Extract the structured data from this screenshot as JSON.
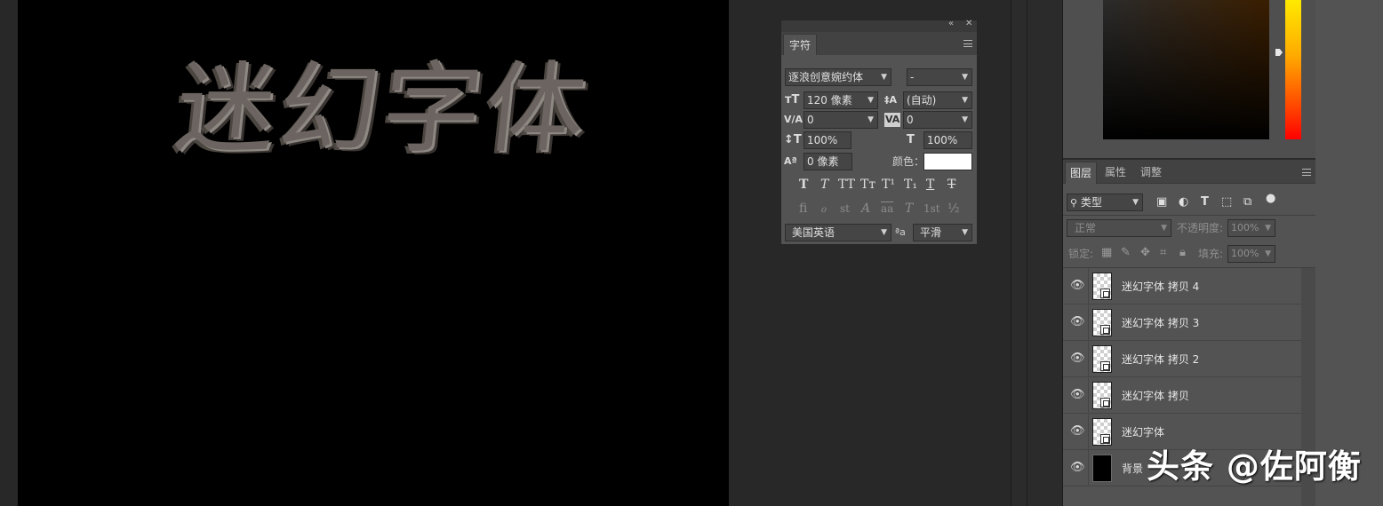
{
  "canvas": {
    "text": "迷幻字体"
  },
  "character_panel": {
    "collapse_icon": "double-chevron-left",
    "close_icon": "close-x",
    "tab_label": "字符",
    "font_family": "逐浪创意婉约体",
    "font_style": "-",
    "font_size": "120 像素",
    "leading": "(自动)",
    "kerning": "0",
    "tracking": "0",
    "vertical_scale": "100%",
    "horizontal_scale": "100%",
    "baseline_shift": "0 像素",
    "color_label": "颜色：",
    "color_value": "#ffffff",
    "style_glyphs": [
      "T",
      "T",
      "TT",
      "Tт",
      "T¹",
      "T₁",
      "T",
      "T"
    ],
    "opentype_glyphs": [
      "ﬁ",
      "ℴ",
      "st",
      "A",
      "aa",
      "T",
      "1st",
      "½"
    ],
    "language": "美国英语",
    "aa_label": "ªa",
    "antialias": "平滑"
  },
  "layers_panel": {
    "tabs": [
      "图层",
      "属性",
      "调整"
    ],
    "filter_kind": "类型",
    "blend_mode": "正常",
    "opacity_label": "不透明度:",
    "opacity_value": "100%",
    "lock_label": "锁定:",
    "fill_label": "填充:",
    "fill_value": "100%",
    "layers": [
      {
        "name": "迷幻字体 拷贝 4",
        "type": "smart-object"
      },
      {
        "name": "迷幻字体 拷贝 3",
        "type": "smart-object"
      },
      {
        "name": "迷幻字体 拷贝 2",
        "type": "smart-object"
      },
      {
        "name": "迷幻字体 拷贝",
        "type": "smart-object"
      },
      {
        "name": "迷幻字体",
        "type": "smart-object"
      },
      {
        "name": "背景",
        "type": "background"
      }
    ]
  },
  "watermark": "头条 @佐阿衡"
}
